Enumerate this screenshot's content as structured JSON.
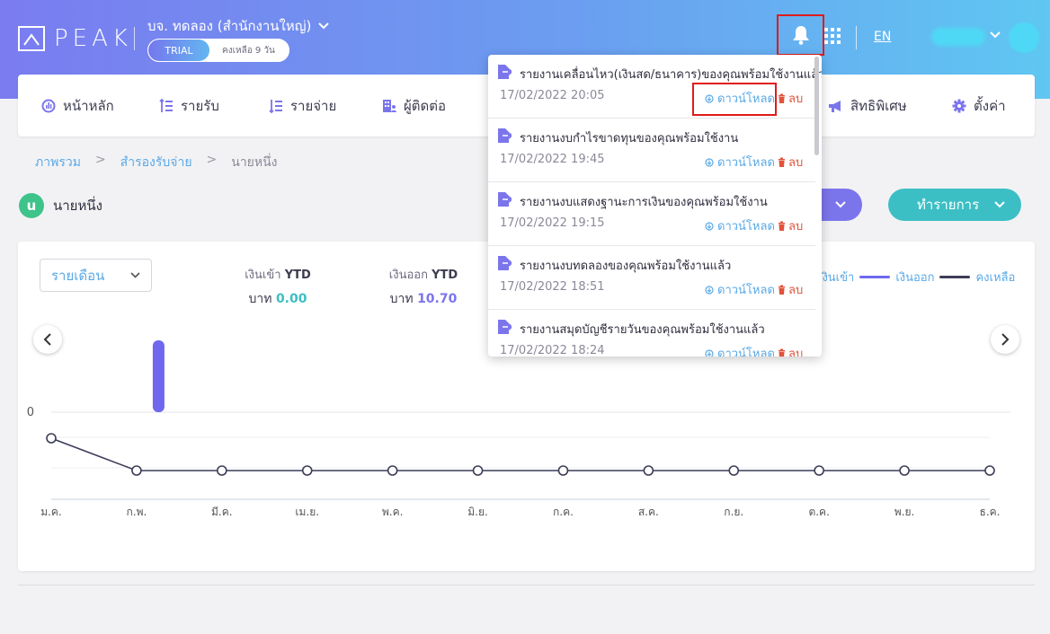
{
  "header": {
    "logo_text": "PEAK",
    "company_name": "บจ. ทดลอง (สำนักงานใหญ่)",
    "trial_label": "TRIAL",
    "trial_remaining": "คงเหลือ 9 วัน",
    "language": "EN"
  },
  "nav": {
    "items": [
      {
        "label": "หน้าหลัก",
        "icon": "dashboard-icon"
      },
      {
        "label": "รายรับ",
        "icon": "income-icon"
      },
      {
        "label": "รายจ่าย",
        "icon": "expense-icon"
      },
      {
        "label": "ผู้ติดต่อ",
        "icon": "contacts-icon"
      },
      {
        "label": "สิทธิพิเศษ",
        "icon": "megaphone-icon"
      },
      {
        "label": "ตั้งค่า",
        "icon": "gear-icon"
      }
    ]
  },
  "breadcrumb": {
    "items": [
      "ภาพรวม",
      "สำรองรับจ่าย",
      "นายหนึ่ง"
    ],
    "separator": ">"
  },
  "entity": {
    "initial": "u",
    "name": "นายหนึ่ง",
    "badge_color": "#3ec48a"
  },
  "actions": {
    "transact_label": "ทำรายการ"
  },
  "summary": {
    "period": "รายเดือน",
    "income_label": "เงินเข้า",
    "outgo_label": "เงินออก",
    "ytd": "YTD",
    "currency": "บาท",
    "income_value": "0.00",
    "outgo_value": "10.70"
  },
  "chart_data": {
    "type": "bar",
    "categories": [
      "ม.ค.",
      "ก.พ.",
      "มี.ค.",
      "เม.ย.",
      "พ.ค.",
      "มิ.ย.",
      "ก.ค.",
      "ส.ค.",
      "ก.ย.",
      "ต.ค.",
      "พ.ย.",
      "ธ.ค."
    ],
    "series": [
      {
        "name": "เงินเข้า",
        "values": [
          0,
          0,
          0,
          0,
          0,
          0,
          0,
          0,
          0,
          0,
          0,
          0
        ]
      },
      {
        "name": "เงินออก",
        "values": [
          0,
          10.7,
          0,
          0,
          0,
          0,
          0,
          0,
          0,
          0,
          0,
          0
        ]
      },
      {
        "name": "คงเหลือ",
        "type": "line",
        "values": [
          0,
          -10.7,
          -10.7,
          -10.7,
          -10.7,
          -10.7,
          -10.7,
          -10.7,
          -10.7,
          -10.7,
          -10.7,
          -10.7
        ]
      }
    ],
    "y_tick_label": "0",
    "legend": [
      "เงินเข้า",
      "เงินออก",
      "คงเหลือ"
    ],
    "legend_position": "top-right",
    "colors": {
      "income": "#3cbfc4",
      "outgo": "#6f68ee",
      "balance": "#3c3c58"
    }
  },
  "notifications": [
    {
      "title": "รายงานเคลื่อนไหว(เงินสด/ธนาคาร)ของคุณพร้อมใช้งานแล้ว",
      "date": "17/02/2022 20:05"
    },
    {
      "title": "รายงานงบกำไรขาดทุนของคุณพร้อมใช้งาน",
      "date": "17/02/2022 19:45"
    },
    {
      "title": "รายงานงบแสดงฐานะการเงินของคุณพร้อมใช้งาน",
      "date": "17/02/2022 19:15"
    },
    {
      "title": "รายงานงบทดลองของคุณพร้อมใช้งานแล้ว",
      "date": "17/02/2022 18:51"
    },
    {
      "title": "รายงานสมุดบัญชีรายวันของคุณพร้อมใช้งานแล้ว",
      "date": "17/02/2022 18:24"
    }
  ],
  "notification_actions": {
    "download_label": "ดาวน์โหลด",
    "delete_label": "ลบ"
  }
}
